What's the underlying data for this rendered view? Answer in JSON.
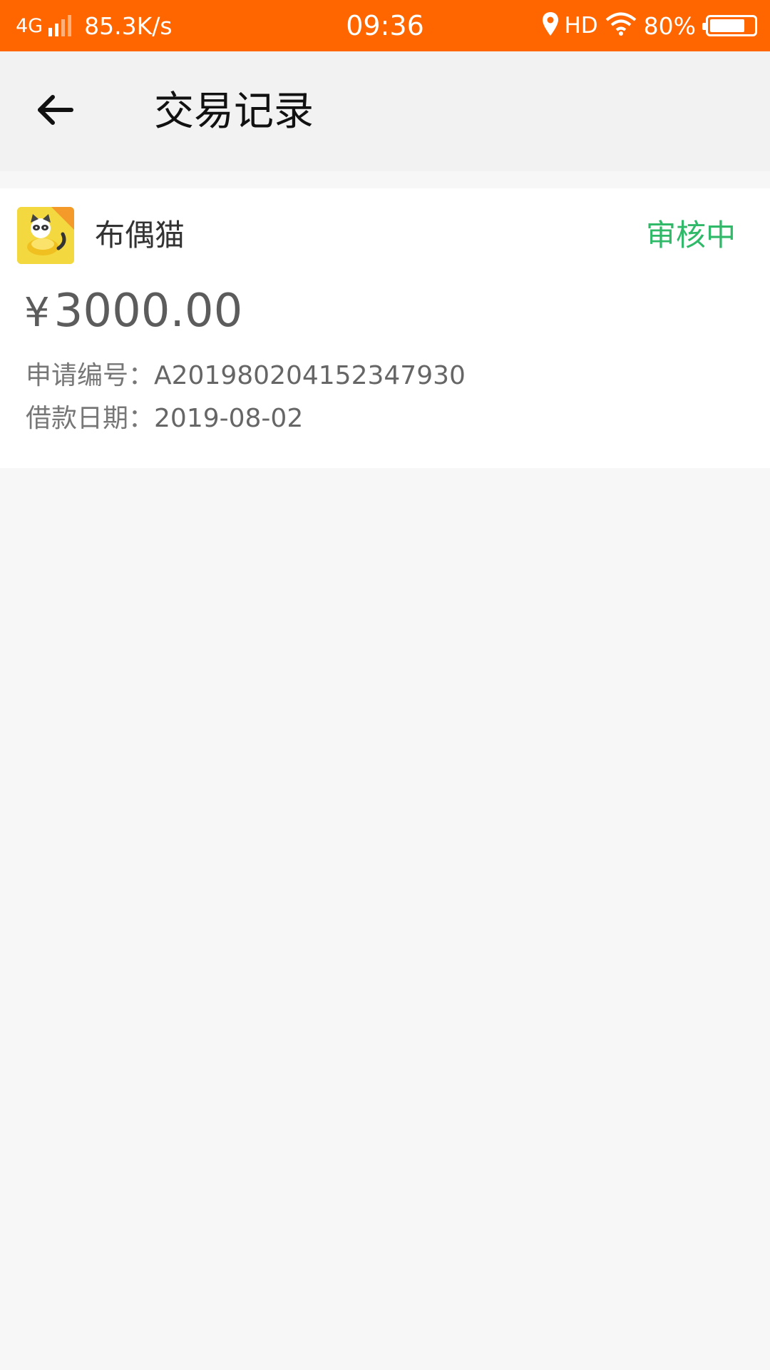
{
  "status_bar": {
    "network": "4G",
    "speed": "85.3K/s",
    "time": "09:36",
    "hd": "HD",
    "battery_percent": "80%",
    "battery_level": 0.8,
    "color": "#ff6600"
  },
  "nav": {
    "back_icon": "arrow-left-icon",
    "title": "交易记录"
  },
  "record": {
    "app_name": "布偶猫",
    "status": "审核中",
    "status_color": "#2fb969",
    "currency": "¥",
    "amount": "3000.00",
    "application_no_label": "申请编号：",
    "application_no": "A20198020415234793​0",
    "loan_date_label": "借款日期：",
    "loan_date": "2019-08-02"
  }
}
